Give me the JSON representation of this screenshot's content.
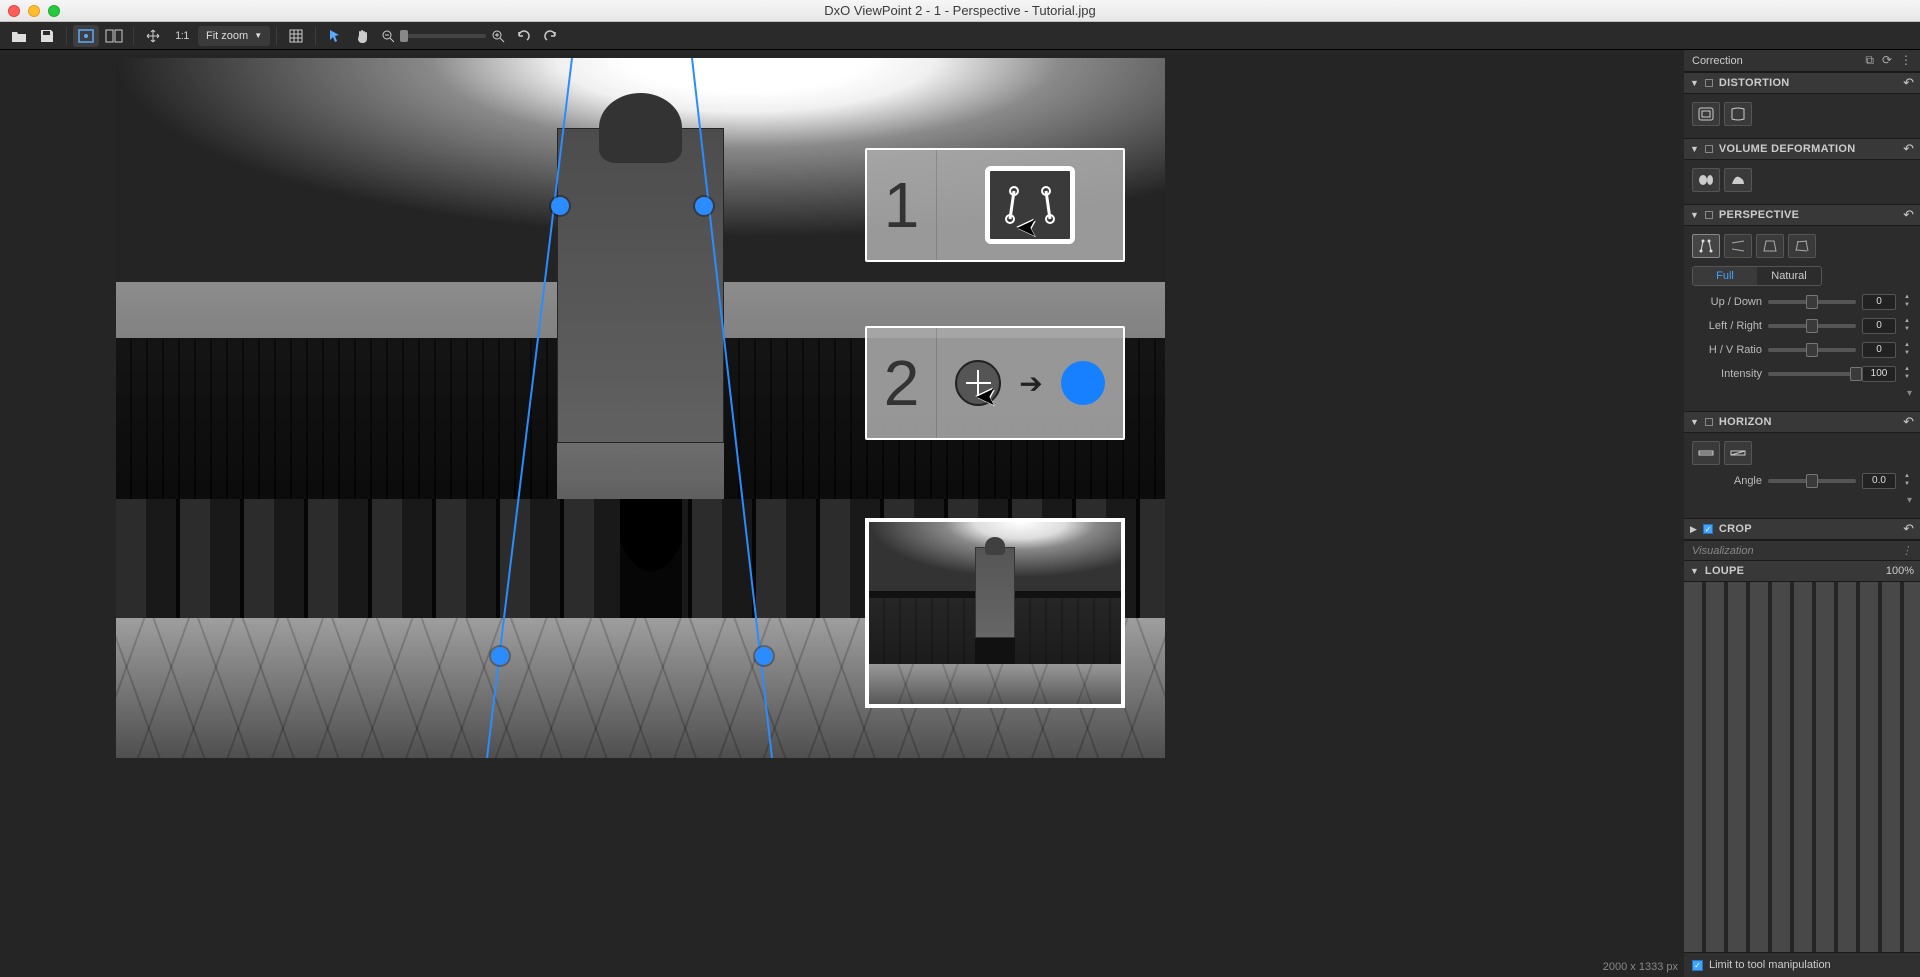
{
  "titlebar": {
    "title": "DxO ViewPoint 2 - 1 - Perspective - Tutorial.jpg"
  },
  "toolbar": {
    "one_to_one": "1:1",
    "fit_zoom": "Fit zoom"
  },
  "canvas": {
    "dimensions": "2000 x 1333 px",
    "tutorial": {
      "step1": "1",
      "step2": "2"
    }
  },
  "side": {
    "header": "Correction",
    "distortion": {
      "title": "DISTORTION"
    },
    "volume": {
      "title": "VOLUME DEFORMATION"
    },
    "perspective": {
      "title": "PERSPECTIVE",
      "seg_full": "Full",
      "seg_natural": "Natural",
      "up_down": {
        "label": "Up / Down",
        "value": "0"
      },
      "left_right": {
        "label": "Left / Right",
        "value": "0"
      },
      "hv_ratio": {
        "label": "H / V Ratio",
        "value": "0"
      },
      "intensity": {
        "label": "Intensity",
        "value": "100"
      }
    },
    "horizon": {
      "title": "HORIZON",
      "angle": {
        "label": "Angle",
        "value": "0.0"
      }
    },
    "crop": {
      "title": "CROP"
    },
    "viz": "Visualization",
    "loupe": {
      "title": "LOUPE",
      "zoom": "100%"
    },
    "limit_checkbox": "Limit to tool manipulation"
  }
}
